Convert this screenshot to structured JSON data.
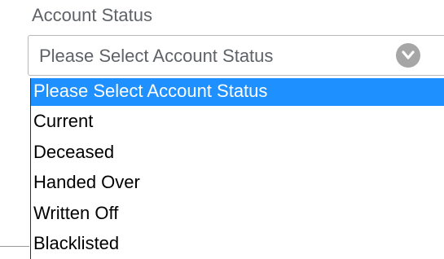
{
  "field": {
    "label": "Account Status"
  },
  "select": {
    "value": "Please Select Account Status",
    "chevron_icon": "chevron-down-icon"
  },
  "dropdown": {
    "options": [
      {
        "label": "Please Select Account Status",
        "selected": true
      },
      {
        "label": "Current",
        "selected": false
      },
      {
        "label": "Deceased",
        "selected": false
      },
      {
        "label": "Handed Over",
        "selected": false
      },
      {
        "label": "Written Off",
        "selected": false
      },
      {
        "label": "Blacklisted",
        "selected": false
      }
    ]
  },
  "colors": {
    "highlight": "#1e90ff",
    "label_text": "#5f6368",
    "chevron_bg": "#a6a6a6"
  }
}
